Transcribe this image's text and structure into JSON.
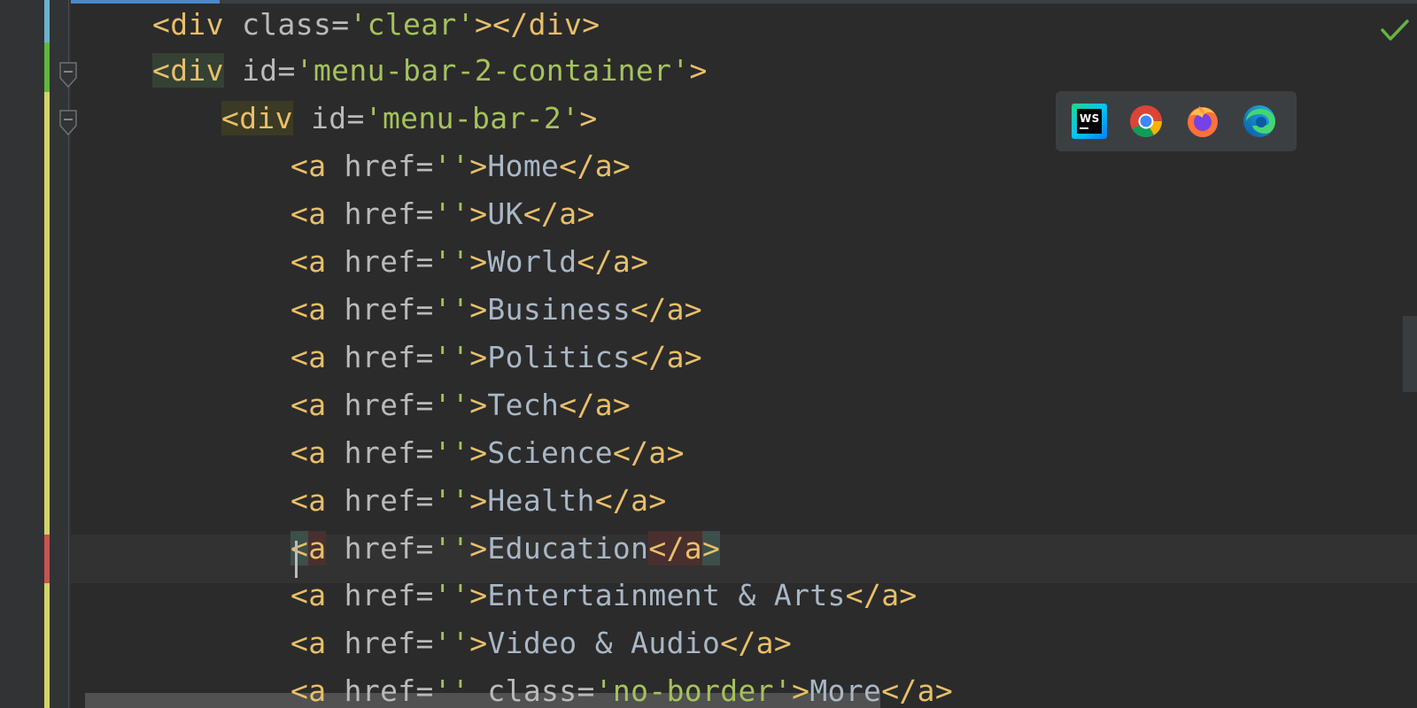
{
  "editor": {
    "lines": [
      {
        "segments": [
          {
            "t": "<div",
            "c": "tag"
          },
          {
            "t": " "
          },
          {
            "t": "class",
            "c": "attr"
          },
          {
            "t": "=",
            "c": "eq"
          },
          {
            "t": "'clear'",
            "c": "str"
          },
          {
            "t": "></div>",
            "c": "tag"
          }
        ]
      },
      {
        "segments": [
          {
            "t": "<div",
            "c": "tag",
            "hl": "green"
          },
          {
            "t": " "
          },
          {
            "t": "id",
            "c": "attr"
          },
          {
            "t": "=",
            "c": "eq"
          },
          {
            "t": "'menu-bar-2-container'",
            "c": "str"
          },
          {
            "t": ">",
            "c": "tag"
          }
        ]
      },
      {
        "segments": [
          {
            "t": "<div",
            "c": "tag",
            "hl": "yellow"
          },
          {
            "t": " "
          },
          {
            "t": "id",
            "c": "attr"
          },
          {
            "t": "=",
            "c": "eq"
          },
          {
            "t": "'menu-bar-2'",
            "c": "str"
          },
          {
            "t": ">",
            "c": "tag"
          }
        ]
      },
      {
        "segments": [
          {
            "t": "<a",
            "c": "tag"
          },
          {
            "t": " "
          },
          {
            "t": "href",
            "c": "attr"
          },
          {
            "t": "=",
            "c": "eq"
          },
          {
            "t": "''",
            "c": "str"
          },
          {
            "t": ">",
            "c": "tag"
          },
          {
            "t": "Home",
            "c": "text"
          },
          {
            "t": "</a>",
            "c": "tag"
          }
        ]
      },
      {
        "segments": [
          {
            "t": "<a",
            "c": "tag"
          },
          {
            "t": " "
          },
          {
            "t": "href",
            "c": "attr"
          },
          {
            "t": "=",
            "c": "eq"
          },
          {
            "t": "''",
            "c": "str"
          },
          {
            "t": ">",
            "c": "tag"
          },
          {
            "t": "UK",
            "c": "text"
          },
          {
            "t": "</a>",
            "c": "tag"
          }
        ]
      },
      {
        "segments": [
          {
            "t": "<a",
            "c": "tag"
          },
          {
            "t": " "
          },
          {
            "t": "href",
            "c": "attr"
          },
          {
            "t": "=",
            "c": "eq"
          },
          {
            "t": "''",
            "c": "str"
          },
          {
            "t": ">",
            "c": "tag"
          },
          {
            "t": "World",
            "c": "text"
          },
          {
            "t": "</a>",
            "c": "tag"
          }
        ]
      },
      {
        "segments": [
          {
            "t": "<a",
            "c": "tag"
          },
          {
            "t": " "
          },
          {
            "t": "href",
            "c": "attr"
          },
          {
            "t": "=",
            "c": "eq"
          },
          {
            "t": "''",
            "c": "str"
          },
          {
            "t": ">",
            "c": "tag"
          },
          {
            "t": "Business",
            "c": "text"
          },
          {
            "t": "</a>",
            "c": "tag"
          }
        ]
      },
      {
        "segments": [
          {
            "t": "<a",
            "c": "tag"
          },
          {
            "t": " "
          },
          {
            "t": "href",
            "c": "attr"
          },
          {
            "t": "=",
            "c": "eq"
          },
          {
            "t": "''",
            "c": "str"
          },
          {
            "t": ">",
            "c": "tag"
          },
          {
            "t": "Politics",
            "c": "text"
          },
          {
            "t": "</a>",
            "c": "tag"
          }
        ]
      },
      {
        "segments": [
          {
            "t": "<a",
            "c": "tag"
          },
          {
            "t": " "
          },
          {
            "t": "href",
            "c": "attr"
          },
          {
            "t": "=",
            "c": "eq"
          },
          {
            "t": "''",
            "c": "str"
          },
          {
            "t": ">",
            "c": "tag"
          },
          {
            "t": "Tech",
            "c": "text"
          },
          {
            "t": "</a>",
            "c": "tag"
          }
        ]
      },
      {
        "segments": [
          {
            "t": "<a",
            "c": "tag"
          },
          {
            "t": " "
          },
          {
            "t": "href",
            "c": "attr"
          },
          {
            "t": "=",
            "c": "eq"
          },
          {
            "t": "''",
            "c": "str"
          },
          {
            "t": ">",
            "c": "tag"
          },
          {
            "t": "Science",
            "c": "text"
          },
          {
            "t": "</a>",
            "c": "tag"
          }
        ]
      },
      {
        "segments": [
          {
            "t": "<a",
            "c": "tag"
          },
          {
            "t": " "
          },
          {
            "t": "href",
            "c": "attr"
          },
          {
            "t": "=",
            "c": "eq"
          },
          {
            "t": "''",
            "c": "str"
          },
          {
            "t": ">",
            "c": "tag"
          },
          {
            "t": "Health",
            "c": "text"
          },
          {
            "t": "</a>",
            "c": "tag"
          }
        ]
      },
      {
        "segments": [
          {
            "t": "<",
            "c": "tag",
            "hl": "teal"
          },
          {
            "t": "a",
            "c": "tag",
            "hl": "red"
          },
          {
            "t": " "
          },
          {
            "t": "href",
            "c": "attr"
          },
          {
            "t": "=",
            "c": "eq"
          },
          {
            "t": "''",
            "c": "str"
          },
          {
            "t": ">",
            "c": "tag"
          },
          {
            "t": "Education",
            "c": "text"
          },
          {
            "t": "</a",
            "c": "tag",
            "hl": "red"
          },
          {
            "t": ">",
            "c": "tag",
            "hl": "teal"
          }
        ]
      },
      {
        "segments": [
          {
            "t": "<a",
            "c": "tag"
          },
          {
            "t": " "
          },
          {
            "t": "href",
            "c": "attr"
          },
          {
            "t": "=",
            "c": "eq"
          },
          {
            "t": "''",
            "c": "str"
          },
          {
            "t": ">",
            "c": "tag"
          },
          {
            "t": "Entertainment & Arts",
            "c": "text"
          },
          {
            "t": "</a>",
            "c": "tag"
          }
        ]
      },
      {
        "segments": [
          {
            "t": "<a",
            "c": "tag"
          },
          {
            "t": " "
          },
          {
            "t": "href",
            "c": "attr"
          },
          {
            "t": "=",
            "c": "eq"
          },
          {
            "t": "''",
            "c": "str"
          },
          {
            "t": ">",
            "c": "tag"
          },
          {
            "t": "Video & Audio",
            "c": "text"
          },
          {
            "t": "</a>",
            "c": "tag"
          }
        ]
      },
      {
        "segments": [
          {
            "t": "<a",
            "c": "tag"
          },
          {
            "t": " "
          },
          {
            "t": "href",
            "c": "attr"
          },
          {
            "t": "=",
            "c": "eq"
          },
          {
            "t": "''",
            "c": "str"
          },
          {
            "t": " "
          },
          {
            "t": "class",
            "c": "attr"
          },
          {
            "t": "=",
            "c": "eq"
          },
          {
            "t": "'no-border'",
            "c": "str"
          },
          {
            "t": ">",
            "c": "tag"
          },
          {
            "t": "More",
            "c": "text"
          },
          {
            "t": "</a>",
            "c": "tag"
          }
        ]
      }
    ]
  },
  "browser_popup": {
    "icons": [
      "webstorm-icon",
      "chrome-icon",
      "firefox-icon",
      "edge-icon"
    ]
  },
  "status": {
    "icon": "inspection-ok-checkmark-icon"
  },
  "colors": {
    "background": "#2b2b2b",
    "gutter": "#313335",
    "tag": "#e8bf6a",
    "attr": "#bababa",
    "string": "#a5c25c",
    "text": "#a9b7c6",
    "change_modified": "#d4d36a",
    "change_added": "#62b543",
    "change_deleted": "#c75450",
    "status_ok": "#62b543"
  }
}
